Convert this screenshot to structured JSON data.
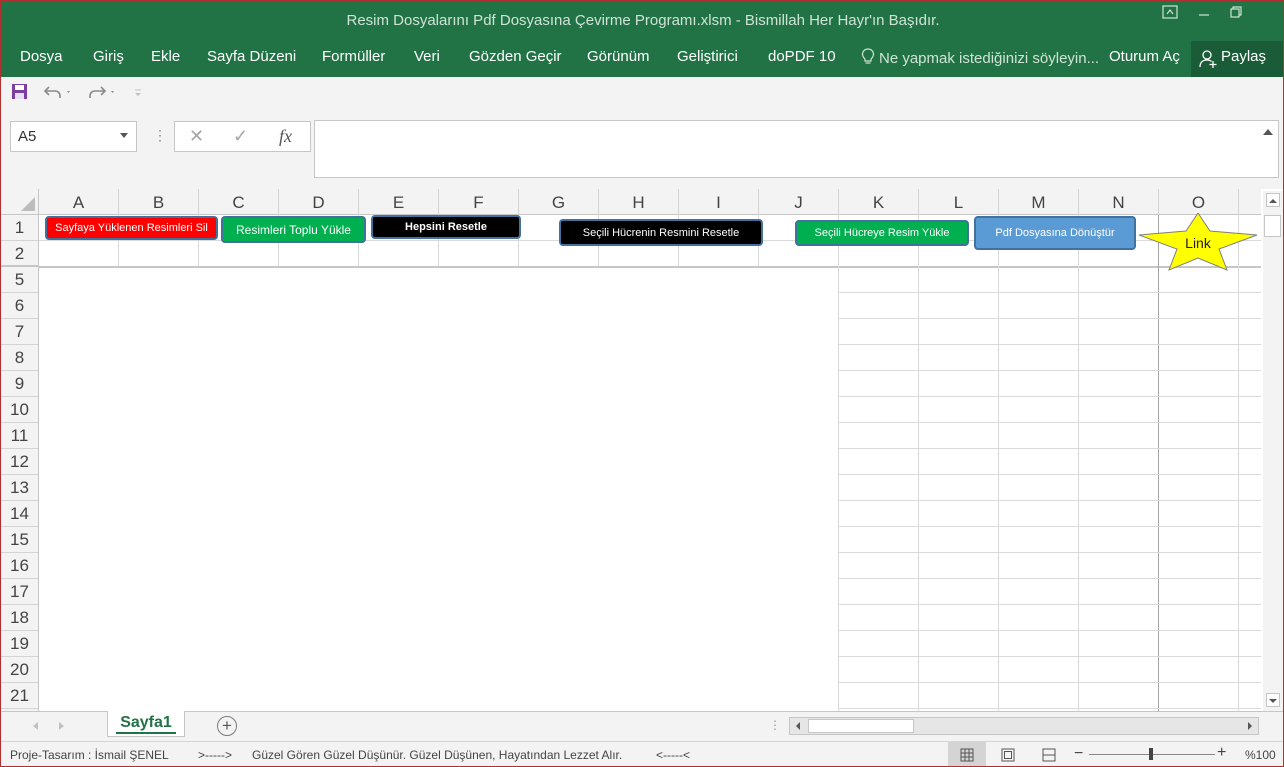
{
  "window": {
    "title": "Resim Dosyalarını Pdf Dosyasına Çevirme Programı.xlsm - Bismillah Her Hayr'ın Başıdır."
  },
  "ribbon": {
    "tabs": [
      "Dosya",
      "Giriş",
      "Ekle",
      "Sayfa Düzeni",
      "Formüller",
      "Veri",
      "Gözden Geçir",
      "Görünüm",
      "Geliştirici",
      "doPDF 10"
    ],
    "tell_me": "Ne yapmak istediğinizi söyleyin...",
    "sign_in": "Oturum Aç",
    "share": "Paylaş"
  },
  "formula_bar": {
    "name_box": "A5",
    "cancel": "✕",
    "enter": "✓",
    "fx": "fx",
    "value": ""
  },
  "grid": {
    "columns": [
      "A",
      "B",
      "C",
      "D",
      "E",
      "F",
      "G",
      "H",
      "I",
      "J",
      "K",
      "L",
      "M",
      "N",
      "O"
    ],
    "rows": [
      "1",
      "2",
      "5",
      "6",
      "7",
      "8",
      "9",
      "10",
      "11",
      "12",
      "13",
      "14",
      "15",
      "16",
      "17",
      "18",
      "19",
      "20",
      "21"
    ]
  },
  "shapes": {
    "delete_images": {
      "label": "Sayfaya Yüklenen Resimleri Sil",
      "color": "#ff0000"
    },
    "bulk_upload": {
      "label": "Resimleri Toplu Yükle",
      "color": "#00b050"
    },
    "reset_all": {
      "label": "Hepsini  Resetle",
      "color": "#000000"
    },
    "reset_selected": {
      "label": "Seçili Hücrenin Resmini Resetle",
      "color": "#000000"
    },
    "upload_selected": {
      "label": "Seçili Hücreye Resim Yükle",
      "color": "#00b050"
    },
    "convert_pdf": {
      "label": "Pdf Dosyasına Dönüştür",
      "color": "#5b9bd5"
    },
    "link": {
      "label": "Link",
      "color": "#ffff00"
    }
  },
  "sheets": {
    "active": "Sayfa1"
  },
  "status": {
    "author": "Proje-Tasarım : İsmail ŞENEL",
    "arrow_right": ">----->",
    "motto": "Güzel Gören Güzel Düşünür. Güzel Düşünen, Hayatından Lezzet Alır.",
    "arrow_left": "<-----<",
    "zoom": "%100"
  },
  "colors": {
    "excel_green": "#217346",
    "chrome_gray": "#f3f3f3"
  }
}
